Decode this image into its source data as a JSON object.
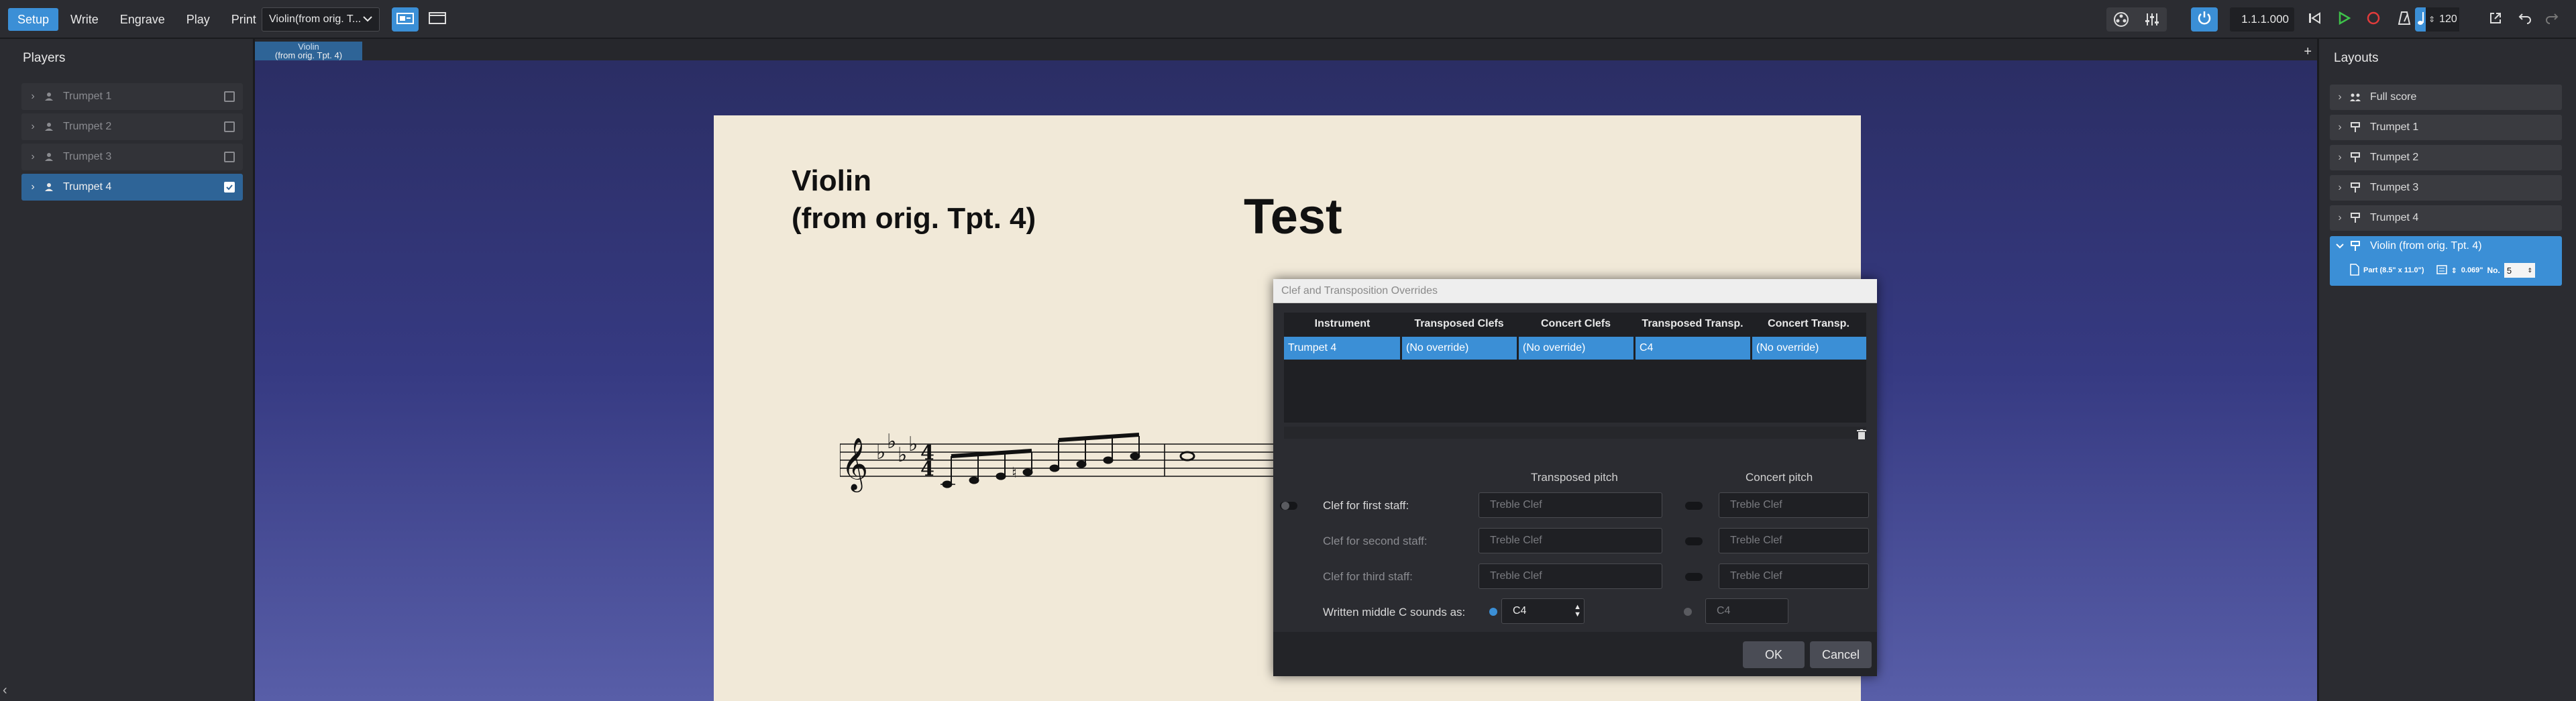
{
  "toolbar": {
    "modes": [
      "Setup",
      "Write",
      "Engrave",
      "Play",
      "Print"
    ],
    "active_mode": "Setup",
    "layout_select": "Violin(from orig. T...",
    "position": "1.1.1.000",
    "tempo": "120"
  },
  "players": {
    "title": "Players",
    "items": [
      {
        "name": "Trumpet 1",
        "checked": false
      },
      {
        "name": "Trumpet 2",
        "checked": false
      },
      {
        "name": "Trumpet 3",
        "checked": false
      },
      {
        "name": "Trumpet 4",
        "checked": true
      }
    ]
  },
  "score": {
    "tab_label": "Violin\n(from orig. Tpt. 4)",
    "part_name_line1": "Violin",
    "part_name_line2": "(from orig. Tpt. 4)",
    "title": "Test"
  },
  "layouts": {
    "title": "Layouts",
    "items": [
      "Full score",
      "Trumpet 1",
      "Trumpet 2",
      "Trumpet 3",
      "Trumpet 4"
    ],
    "expanded": {
      "name": "Violin (from orig. Tpt. 4)",
      "page_size": "Part (8.5\" x 11.0\")",
      "staff_size": "0.069\"",
      "number_label": "No.",
      "number_value": "5"
    }
  },
  "dialog": {
    "title": "Clef and Transposition Overrides",
    "columns": [
      "Instrument",
      "Transposed Clefs",
      "Concert Clefs",
      "Transposed Transp.",
      "Concert Transp."
    ],
    "row": [
      "Trumpet 4",
      "(No override)",
      "(No override)",
      "C4",
      "(No override)"
    ],
    "transposed_heading": "Transposed pitch",
    "concert_heading": "Concert pitch",
    "clef_rows": [
      {
        "label": "Clef for first staff:",
        "transposed": "Treble Clef",
        "concert": "Treble Clef"
      },
      {
        "label": "Clef for second staff:",
        "transposed": "Treble Clef",
        "concert": "Treble Clef"
      },
      {
        "label": "Clef for third staff:",
        "transposed": "Treble Clef",
        "concert": "Treble Clef"
      }
    ],
    "middle_c_label": "Written middle C sounds as:",
    "middle_c_transposed": "C4",
    "middle_c_concert": "C4",
    "ok": "OK",
    "cancel": "Cancel"
  },
  "colors": {
    "accent": "#3b8fd6",
    "selected_row": "#2e6497",
    "page": "#f1e9d8"
  }
}
